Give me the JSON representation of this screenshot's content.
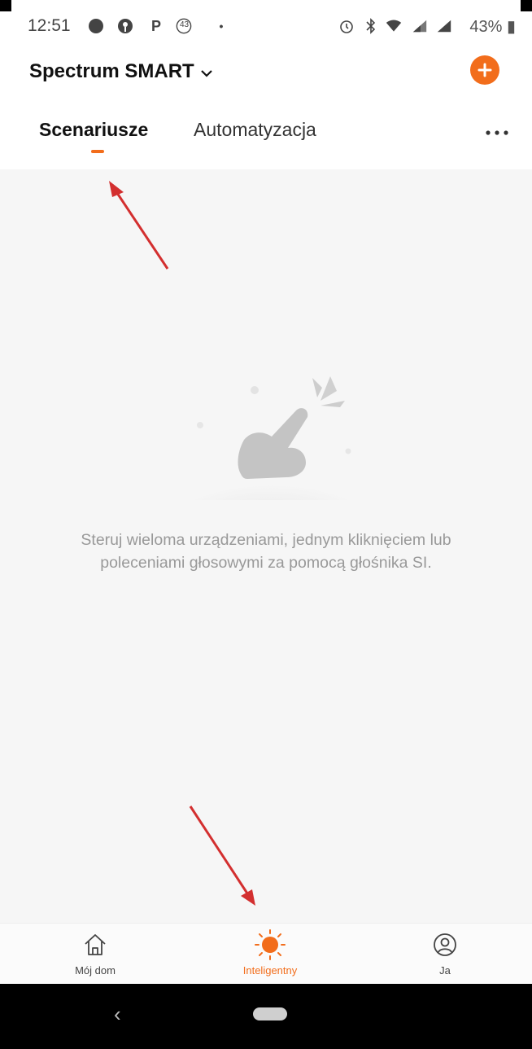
{
  "status_bar": {
    "time": "12:51",
    "notification_badge": "43",
    "battery": "43%"
  },
  "header": {
    "home_name": "Spectrum SMART",
    "add_icon": "plus-icon"
  },
  "tabs": [
    {
      "label": "Scenariusze",
      "active": true
    },
    {
      "label": "Automatyzacja",
      "active": false
    }
  ],
  "more_icon": "more-horizontal-icon",
  "empty_state": {
    "message_line1": "Steruj wieloma urządzeniami, jednym kliknięciem lub",
    "message_line2": "poleceniami głosowymi za pomocą głośnika SI."
  },
  "bottom_nav": [
    {
      "label": "Mój dom",
      "icon": "home-icon",
      "active": false
    },
    {
      "label": "Inteligentny",
      "icon": "sun-icon",
      "active": true
    },
    {
      "label": "Ja",
      "icon": "user-icon",
      "active": false
    }
  ],
  "colors": {
    "accent": "#f26d1b",
    "annotation_arrow": "#d32f2f",
    "muted_text": "#999999"
  }
}
